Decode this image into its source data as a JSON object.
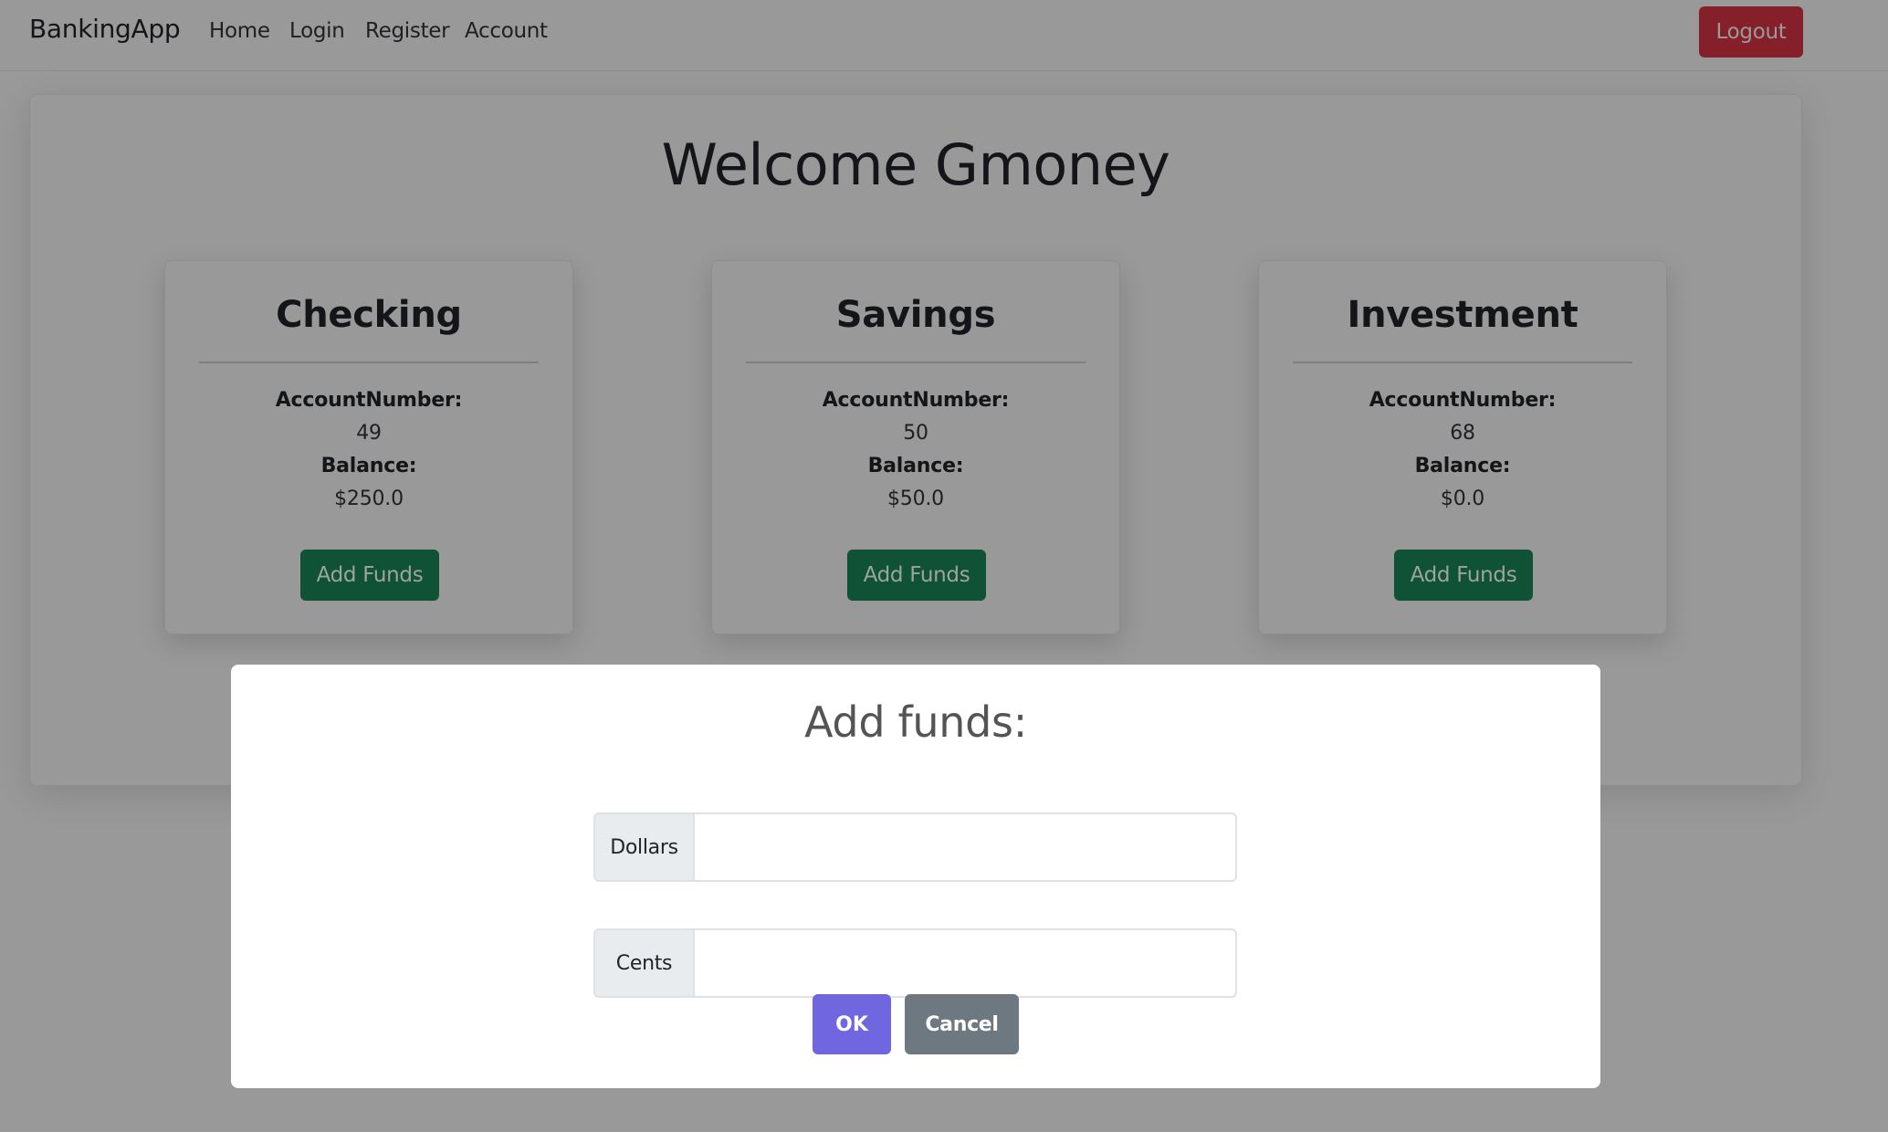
{
  "navbar": {
    "brand": "BankingApp",
    "links": [
      "Home",
      "Login",
      "Register",
      "Account"
    ],
    "logout_label": "Logout"
  },
  "main": {
    "welcome": "Welcome Gmoney",
    "accounts": [
      {
        "title": "Checking",
        "account_number_label": "AccountNumber:",
        "account_number": "49",
        "balance_label": "Balance:",
        "balance": "$250.0",
        "button_label": "Add Funds"
      },
      {
        "title": "Savings",
        "account_number_label": "AccountNumber:",
        "account_number": "50",
        "balance_label": "Balance:",
        "balance": "$50.0",
        "button_label": "Add Funds"
      },
      {
        "title": "Investment",
        "account_number_label": "AccountNumber:",
        "account_number": "68",
        "balance_label": "Balance:",
        "balance": "$0.0",
        "button_label": "Add Funds"
      }
    ]
  },
  "modal": {
    "title": "Add funds:",
    "fields": [
      {
        "label": "Dollars",
        "value": ""
      },
      {
        "label": "Cents",
        "value": ""
      }
    ],
    "ok_label": "OK",
    "cancel_label": "Cancel"
  },
  "colors": {
    "add_funds_button": "#198754",
    "logout_button": "#dc3545",
    "ok_button": "#7066e0",
    "cancel_button": "#6e7881"
  }
}
